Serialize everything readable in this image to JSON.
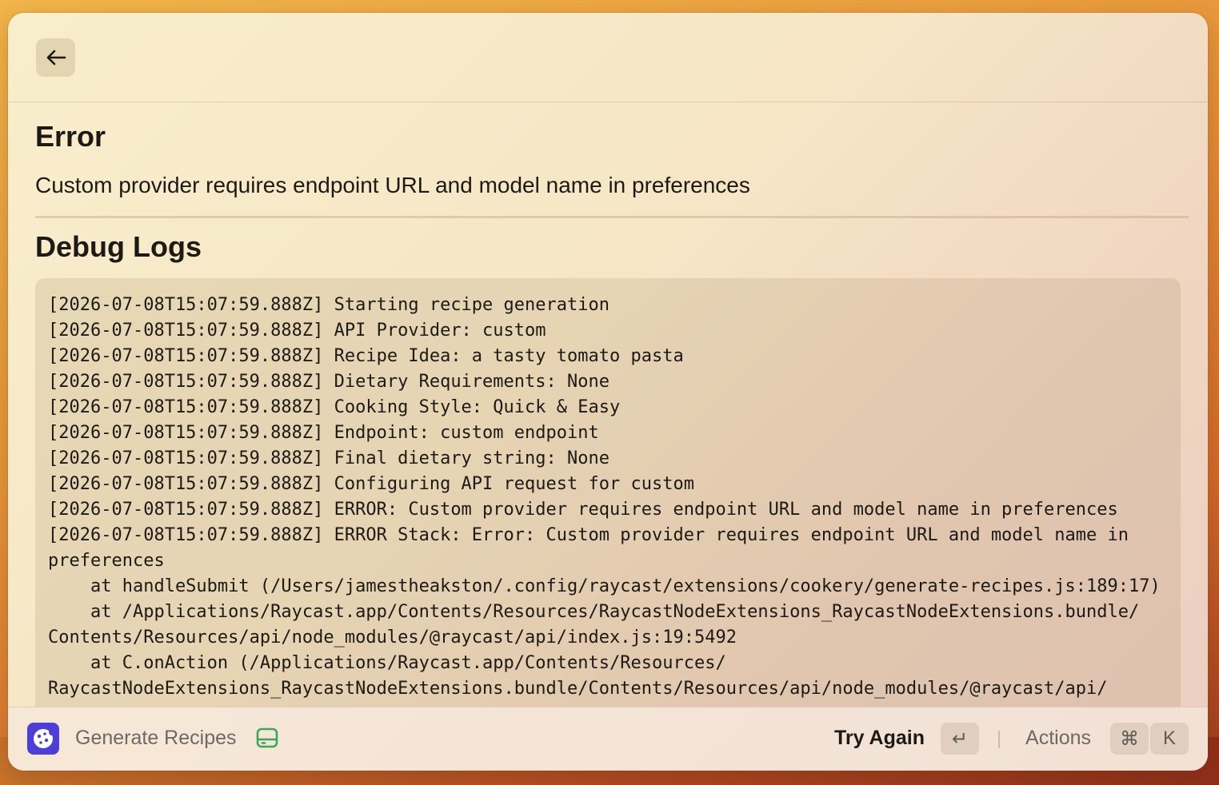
{
  "header": {
    "back_icon": "arrow-left-icon"
  },
  "main": {
    "error_heading": "Error",
    "error_message": "Custom provider requires endpoint URL and model name in preferences",
    "debug_heading": "Debug Logs",
    "logs": [
      "[2026-07-08T15:07:59.888Z] Starting recipe generation",
      "[2026-07-08T15:07:59.888Z] API Provider: custom",
      "[2026-07-08T15:07:59.888Z] Recipe Idea: a tasty tomato pasta",
      "[2026-07-08T15:07:59.888Z] Dietary Requirements: None",
      "[2026-07-08T15:07:59.888Z] Cooking Style: Quick & Easy",
      "[2026-07-08T15:07:59.888Z] Endpoint: custom endpoint",
      "[2026-07-08T15:07:59.888Z] Final dietary string: None",
      "[2026-07-08T15:07:59.888Z] Configuring API request for custom",
      "[2026-07-08T15:07:59.888Z] ERROR: Custom provider requires endpoint URL and model name in preferences",
      "[2026-07-08T15:07:59.888Z] ERROR Stack: Error: Custom provider requires endpoint URL and model name in",
      "preferences",
      "    at handleSubmit (/Users/jamestheakston/.config/raycast/extensions/cookery/generate-recipes.js:189:17)",
      "    at /Applications/Raycast.app/Contents/Resources/RaycastNodeExtensions_RaycastNodeExtensions.bundle/",
      "Contents/Resources/api/node_modules/@raycast/api/index.js:19:5492",
      "    at C.onAction (/Applications/Raycast.app/Contents/Resources/",
      "RaycastNodeExtensions_RaycastNodeExtensions.bundle/Contents/Resources/api/node_modules/@raycast/api/"
    ]
  },
  "footer": {
    "app_name": "Generate Recipes",
    "app_icon": "cookie-icon",
    "status_icon": "hard-drive-icon",
    "primary_action": "Try Again",
    "primary_shortcut": "↵",
    "actions_label": "Actions",
    "actions_shortcut_mod": "⌘",
    "actions_shortcut_key": "K"
  },
  "colors": {
    "accent_icon": "#4d3fd6",
    "status_green": "#3aa85a"
  }
}
